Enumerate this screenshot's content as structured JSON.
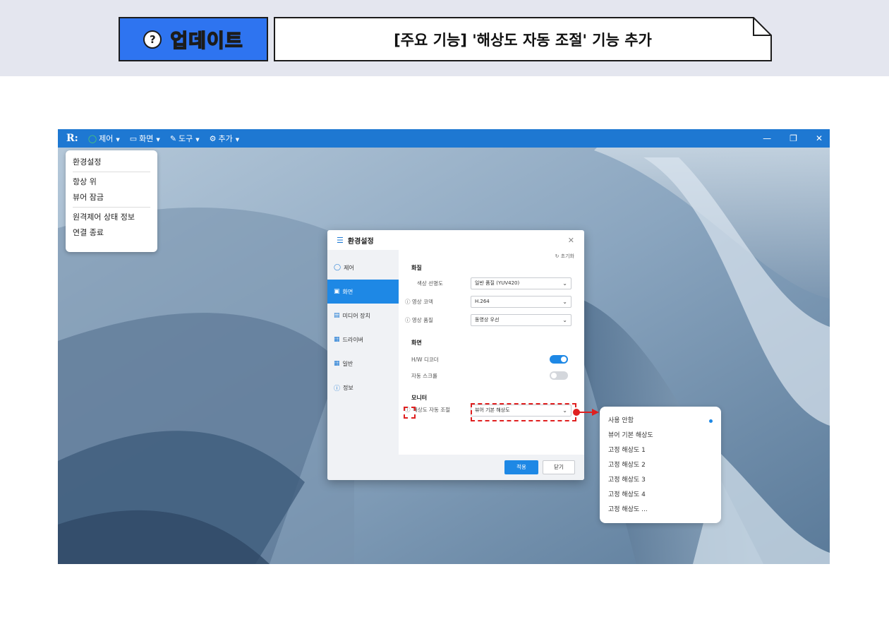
{
  "banner": {
    "badge_label": "업데이트",
    "badge_icon": "question-bubble-icon",
    "title": "[주요 기능] '해상도 자동 조절' 기능 추가"
  },
  "appbar": {
    "logo": "R:",
    "menus": [
      {
        "icon": "power-circle-icon",
        "label": "제어"
      },
      {
        "icon": "monitor-icon",
        "label": "화면"
      },
      {
        "icon": "wrench-icon",
        "label": "도구"
      },
      {
        "icon": "gear-icon",
        "label": "추가"
      }
    ],
    "accent": "#1e78d2"
  },
  "popup_menu": {
    "items": [
      "환경설정",
      "항상 위",
      "뷰어 잠금",
      "원격제어 상태 정보",
      "연결 종료"
    ]
  },
  "dialog": {
    "title": "환경설정",
    "reset": "초기화",
    "nav": [
      {
        "icon": "power-icon",
        "label": "제어",
        "active": false
      },
      {
        "icon": "screen-icon",
        "label": "화면",
        "active": true
      },
      {
        "icon": "media-device-icon",
        "label": "미디어 장치",
        "active": false
      },
      {
        "icon": "driver-icon",
        "label": "드라이버",
        "active": false
      },
      {
        "icon": "grid-icon",
        "label": "일반",
        "active": false
      },
      {
        "icon": "info-icon",
        "label": "정보",
        "active": false
      }
    ],
    "sections": {
      "quality": "화질",
      "screen": "화면",
      "monitor": "모니터"
    },
    "fields": {
      "color_label": "색상 선명도",
      "color_value": "일반 품질 (YUV420)",
      "codec_label": "ⓘ 영상 코덱",
      "codec_value": "H.264",
      "quality_label": "ⓘ 영상 품질",
      "quality_value": "동영상 우선",
      "hw_decoder_label": "H/W 디코더",
      "hw_decoder_on": true,
      "auto_scroll_label": "자동 스크롤",
      "auto_scroll_on": false,
      "auto_resolution_label": "해상도 자동 조절",
      "auto_resolution_value": "뷰어 기본 해상도"
    },
    "apply_label": "적용",
    "close_label": "닫기"
  },
  "dropdown": {
    "options": [
      "사용 안함",
      "뷰어 기본 해상도",
      "고정 해상도 1",
      "고정 해상도 2",
      "고정 해상도 3",
      "고정 해상도 4",
      "고정 해상도 ..."
    ],
    "dot_on_index": 0
  },
  "colors": {
    "accent_blue": "#1e88e5",
    "highlight_red": "#e02020",
    "badge_blue": "#2e74f0"
  }
}
